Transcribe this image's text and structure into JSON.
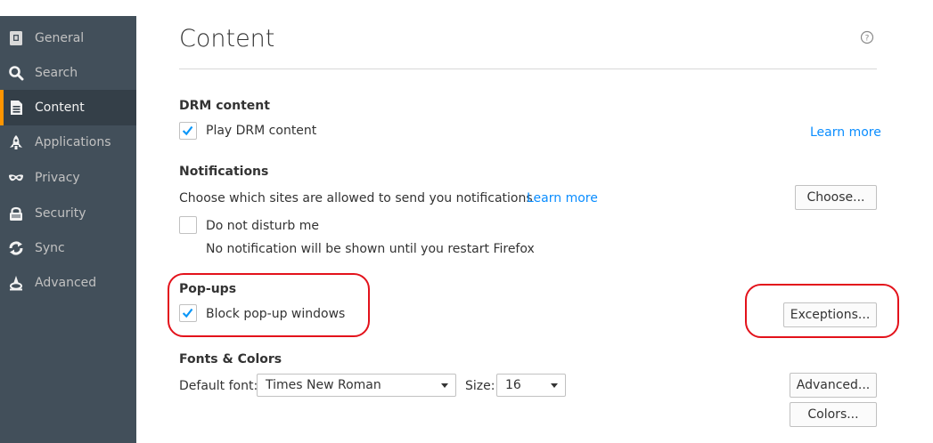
{
  "sidebar": {
    "items": [
      {
        "label": "General",
        "icon": "general-icon"
      },
      {
        "label": "Search",
        "icon": "search-icon"
      },
      {
        "label": "Content",
        "icon": "content-icon",
        "selected": true
      },
      {
        "label": "Applications",
        "icon": "applications-icon"
      },
      {
        "label": "Privacy",
        "icon": "privacy-icon"
      },
      {
        "label": "Security",
        "icon": "security-icon"
      },
      {
        "label": "Sync",
        "icon": "sync-icon"
      },
      {
        "label": "Advanced",
        "icon": "advanced-icon"
      }
    ]
  },
  "main": {
    "title": "Content",
    "help_icon": "help-icon",
    "drm": {
      "heading": "DRM content",
      "checkbox_label": "Play DRM content",
      "checked": true,
      "learn_more": "Learn more"
    },
    "notifications": {
      "heading": "Notifications",
      "description": "Choose which sites are allowed to send you notifications",
      "learn_more": "Learn more",
      "choose_button": "Choose...",
      "dnd_label": "Do not disturb me",
      "dnd_checked": false,
      "dnd_note": "No notification will be shown until you restart Firefox"
    },
    "popups": {
      "heading": "Pop-ups",
      "checkbox_label": "Block pop-up windows",
      "checked": true,
      "exceptions_button": "Exceptions..."
    },
    "fonts": {
      "heading": "Fonts & Colors",
      "default_font_label": "Default font:",
      "default_font_value": "Times New Roman",
      "size_label": "Size:",
      "size_value": "16",
      "advanced_button": "Advanced...",
      "colors_button": "Colors..."
    }
  },
  "colors": {
    "sidebar_bg": "#424f5a",
    "sidebar_selected_bg": "#343f48",
    "selected_accent": "#ff9500",
    "link": "#0a8dff",
    "annotation": "#e3121b"
  }
}
